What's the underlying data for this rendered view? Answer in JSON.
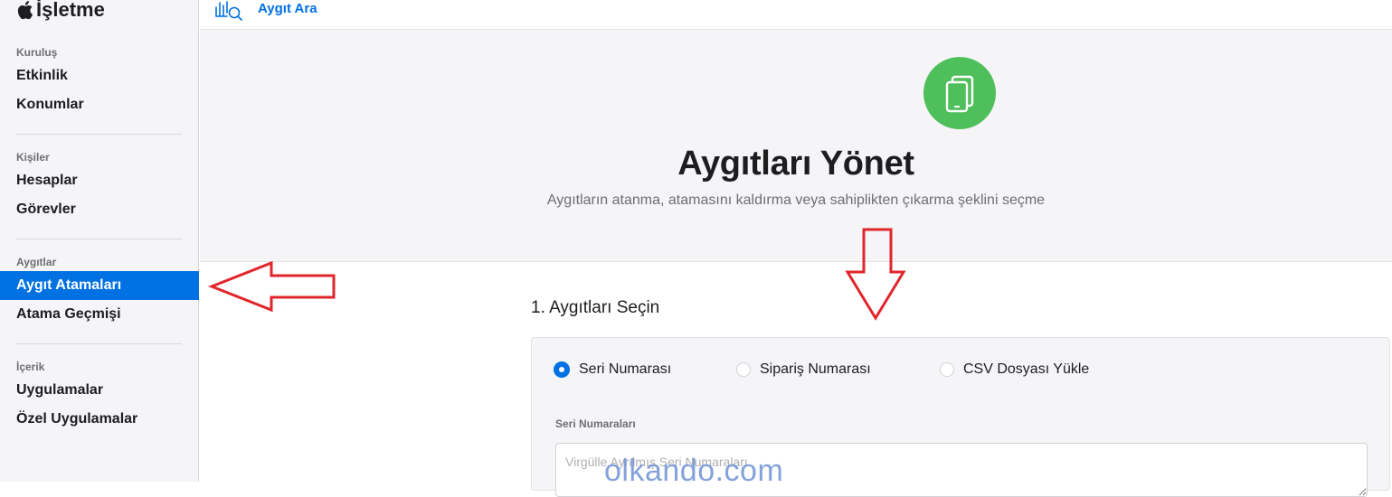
{
  "brand": {
    "name": "İşletme",
    "logo_icon": "apple-logo-icon"
  },
  "sidebar": {
    "groups": [
      {
        "title": "Kuruluş",
        "items": [
          {
            "label": "Etkinlik"
          },
          {
            "label": "Konumlar"
          }
        ]
      },
      {
        "title": "Kişiler",
        "items": [
          {
            "label": "Hesaplar"
          },
          {
            "label": "Görevler"
          }
        ]
      },
      {
        "title": "Aygıtlar",
        "items": [
          {
            "label": "Aygıt Atamaları",
            "active": true
          },
          {
            "label": "Atama Geçmişi"
          }
        ]
      },
      {
        "title": "İçerik",
        "items": [
          {
            "label": "Uygulamalar"
          },
          {
            "label": "Özel Uygulamalar"
          }
        ]
      }
    ]
  },
  "topbar": {
    "search_label": "Aygıt Ara",
    "search_icon": "device-search-icon"
  },
  "hero": {
    "icon": "devices-icon",
    "title": "Aygıtları Yönet",
    "subtitle": "Aygıtların atanma, atamasını kaldırma veya sahiplikten çıkarma şeklini seçme"
  },
  "step1": {
    "title": "1. Aygıtları Seçin",
    "options": [
      {
        "label": "Seri Numarası",
        "checked": true
      },
      {
        "label": "Sipariş Numarası",
        "checked": false
      },
      {
        "label": "CSV Dosyası Yükle",
        "checked": false
      }
    ],
    "field_label": "Seri Numaraları",
    "field_placeholder": "Virgülle Ayrılmış Seri Numaraları",
    "field_value": ""
  },
  "watermark": "olkando.com",
  "colors": {
    "accent": "#0071e3",
    "hero_icon_bg": "#4fbf5b",
    "annotation_arrow": "#e0262b"
  }
}
